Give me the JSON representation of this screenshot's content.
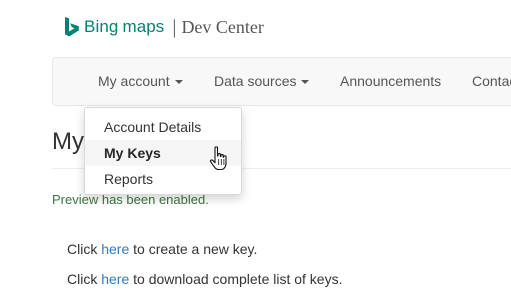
{
  "brand": {
    "logo_text": "Bing",
    "product": "maps",
    "separator": "|",
    "section": "Dev Center",
    "accent_color": "#008373"
  },
  "navbar": {
    "items": [
      {
        "label": "My account",
        "has_caret": true,
        "icon": "caret-down-icon"
      },
      {
        "label": "Data sources",
        "has_caret": true,
        "icon": "caret-down-icon"
      },
      {
        "label": "Announcements",
        "has_caret": false
      },
      {
        "label": "Contac",
        "has_caret": false
      }
    ]
  },
  "dropdown": {
    "items": [
      {
        "label": "Account Details",
        "active": false
      },
      {
        "label": "My Keys",
        "active": true
      },
      {
        "label": "Reports",
        "active": false
      }
    ]
  },
  "page": {
    "heading": "My",
    "preview_note": "Preview has been enabled.",
    "lines": [
      {
        "prefix": "Click ",
        "link": "here",
        "suffix": " to create a new key."
      },
      {
        "prefix": "Click ",
        "link": "here",
        "suffix": " to download complete list of keys."
      }
    ]
  },
  "colors": {
    "link": "#337ab7",
    "success_text": "#3c763d",
    "navbar_bg": "#f8f8f8"
  },
  "cursor": {
    "icon": "hand-pointer-icon"
  }
}
